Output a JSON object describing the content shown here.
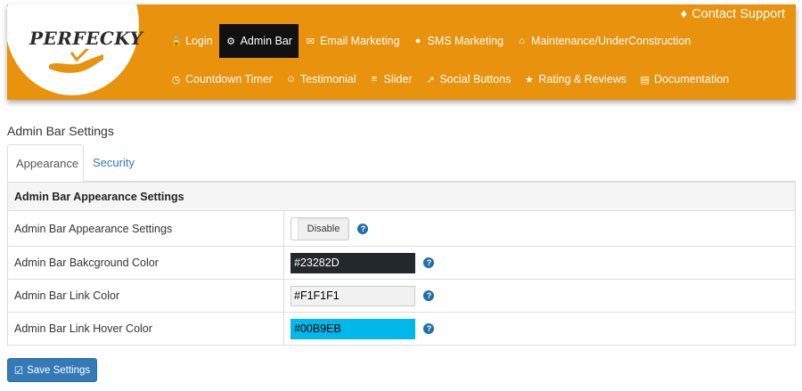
{
  "header": {
    "logo_text": "PERFECKY",
    "contact": {
      "label": "Contact Support",
      "icon": "tag-icon"
    },
    "nav_row1": [
      {
        "label": "Login",
        "icon": "lock-icon",
        "active": false
      },
      {
        "label": "Admin Bar",
        "icon": "gear-icon",
        "active": true
      },
      {
        "label": "Email Marketing",
        "icon": "envelope-icon",
        "active": false
      },
      {
        "label": "SMS Marketing",
        "icon": "chat-icon",
        "active": false
      },
      {
        "label": "Maintenance/UnderConstruction",
        "icon": "home-icon",
        "active": false
      }
    ],
    "nav_row2": [
      {
        "label": "Countdown Timer",
        "icon": "clock-icon",
        "active": false
      },
      {
        "label": "Testimonial",
        "icon": "users-icon",
        "active": false
      },
      {
        "label": "Slider",
        "icon": "sliders-icon",
        "active": false
      },
      {
        "label": "Social Buttons",
        "icon": "share-icon",
        "active": false
      },
      {
        "label": "Rating & Reviews",
        "icon": "star-icon",
        "active": false
      },
      {
        "label": "Documentation",
        "icon": "book-icon",
        "active": false
      }
    ]
  },
  "page": {
    "title": "Admin Bar Settings",
    "tabs": [
      {
        "label": "Appearance",
        "active": true
      },
      {
        "label": "Security",
        "active": false
      }
    ]
  },
  "settings": {
    "section_title": "Admin Bar Appearance Settings",
    "rows": [
      {
        "label": "Admin Bar Appearance Settings",
        "toggle_text": "Disable"
      },
      {
        "label": "Admin Bar Bakcground Color",
        "value": "#23282D",
        "bg": "#23282D",
        "fg": "#ffffff"
      },
      {
        "label": "Admin Bar Link Color",
        "value": "#F1F1F1",
        "bg": "#F1F1F1",
        "fg": "#000000"
      },
      {
        "label": "Admin Bar Link Hover Color",
        "value": "#00B9EB",
        "bg": "#00B9EB",
        "fg": "#000000"
      }
    ],
    "help_glyph": "?"
  },
  "save_button": {
    "label": "Save Settings",
    "icon": "check-square-icon"
  },
  "colors": {
    "header_bg": "#e8920d",
    "active_nav_bg": "#111111",
    "primary": "#337ab7"
  }
}
